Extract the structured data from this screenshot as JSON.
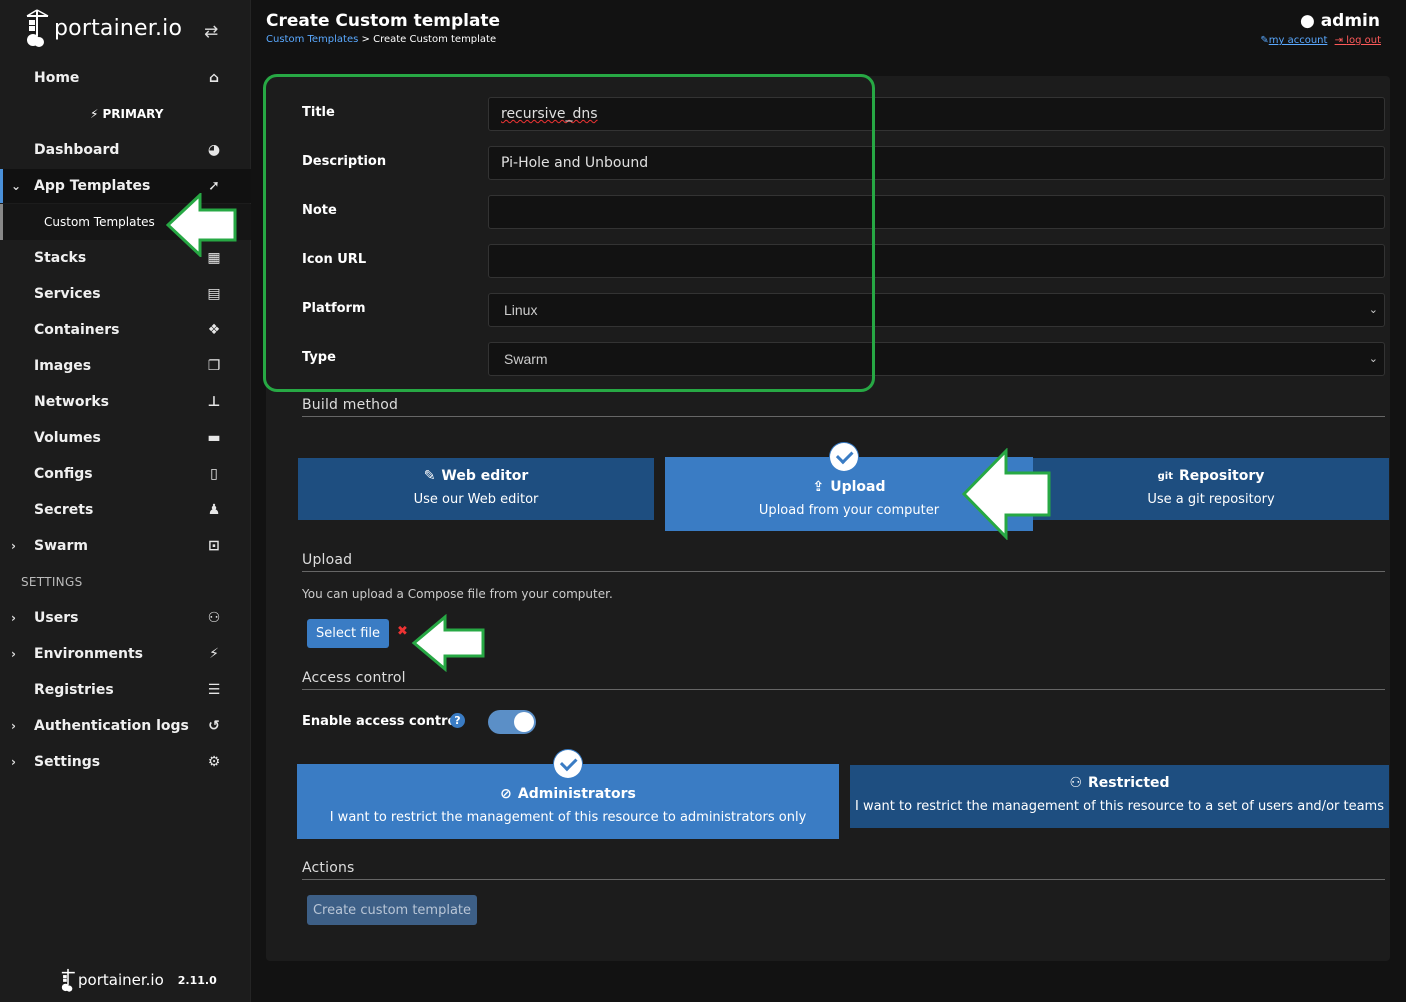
{
  "sidebar": {
    "logo_text": "portainer.io",
    "home": "Home",
    "environment": "PRIMARY",
    "items": [
      {
        "label": "Dashboard",
        "icon": "gauge-icon"
      },
      {
        "label": "App Templates",
        "icon": "rocket-icon"
      },
      {
        "label": "Custom Templates"
      },
      {
        "label": "Stacks",
        "icon": "table-icon"
      },
      {
        "label": "Services",
        "icon": "list-icon"
      },
      {
        "label": "Containers",
        "icon": "cubes-icon"
      },
      {
        "label": "Images",
        "icon": "clone-icon"
      },
      {
        "label": "Networks",
        "icon": "sitemap-icon"
      },
      {
        "label": "Volumes",
        "icon": "hdd-icon"
      },
      {
        "label": "Configs",
        "icon": "file-code-icon"
      },
      {
        "label": "Secrets",
        "icon": "user-secret-icon"
      },
      {
        "label": "Swarm",
        "icon": "object-group-icon"
      }
    ],
    "settings_label": "SETTINGS",
    "settings_items": [
      {
        "label": "Users",
        "icon": "users-icon"
      },
      {
        "label": "Environments",
        "icon": "plug-icon"
      },
      {
        "label": "Registries",
        "icon": "database-icon"
      },
      {
        "label": "Authentication logs",
        "icon": "history-icon"
      },
      {
        "label": "Settings",
        "icon": "cogs-icon"
      }
    ],
    "footer_logo": "portainer.io",
    "version": "2.11.0"
  },
  "header": {
    "title": "Create Custom template",
    "breadcrumb_link": "Custom Templates",
    "breadcrumb_sep": " > ",
    "breadcrumb_current": "Create Custom template",
    "user": "admin",
    "my_account": "my account",
    "log_out": "log out"
  },
  "form": {
    "title_label": "Title",
    "title_value": "recursive_dns",
    "description_label": "Description",
    "description_value": "Pi-Hole and Unbound",
    "note_label": "Note",
    "note_value": "",
    "icon_label": "Icon URL",
    "icon_value": "",
    "platform_label": "Platform",
    "platform_value": "Linux",
    "type_label": "Type",
    "type_value": "Swarm"
  },
  "build": {
    "section": "Build method",
    "options": [
      {
        "title": "Web editor",
        "subtitle": "Use our Web editor",
        "selected": false
      },
      {
        "title": "Upload",
        "subtitle": "Upload from your computer",
        "selected": true
      },
      {
        "title": "Repository",
        "subtitle": "Use a git repository",
        "prefix": "git",
        "selected": false
      }
    ]
  },
  "upload": {
    "section": "Upload",
    "help": "You can upload a Compose file from your computer.",
    "select_file": "Select file",
    "clear_icon": "✖"
  },
  "access": {
    "section": "Access control",
    "toggle_label": "Enable access control",
    "toggle_on": true,
    "admin_title": "Administrators",
    "admin_desc": "I want to restrict the management of this resource to administrators only",
    "restricted_title": "Restricted",
    "restricted_desc": "I want to restrict the management of this resource to a set of users and/or teams"
  },
  "actions": {
    "section": "Actions",
    "create": "Create custom template"
  },
  "colors": {
    "accent": "#3a7cc4",
    "dark_blue": "#1e4e80",
    "annotation_green": "#27a844"
  }
}
